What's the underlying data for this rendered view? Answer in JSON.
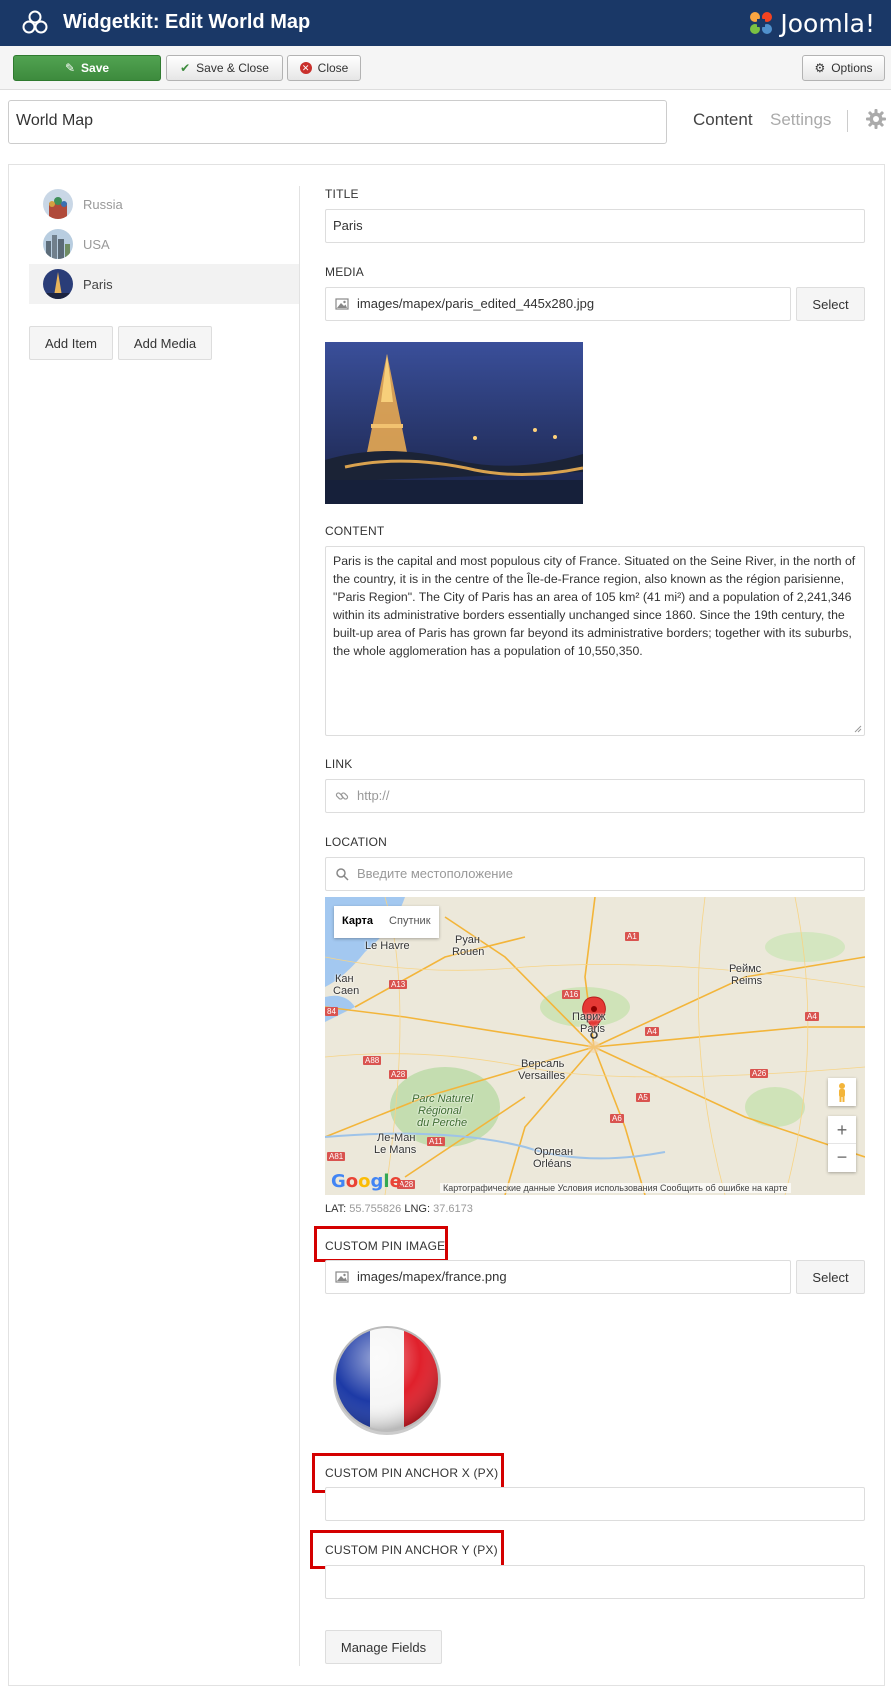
{
  "header": {
    "title": "Widgetkit: Edit World Map",
    "brand": "Joomla!"
  },
  "toolbar": {
    "save_label": "Save",
    "save_close_label": "Save & Close",
    "close_label": "Close",
    "options_label": "Options"
  },
  "widget": {
    "name": "World Map"
  },
  "tabs": {
    "content": "Content",
    "settings": "Settings"
  },
  "items": [
    {
      "label": "Russia"
    },
    {
      "label": "USA"
    },
    {
      "label": "Paris"
    }
  ],
  "item_buttons": {
    "add_item": "Add Item",
    "add_media": "Add Media"
  },
  "form": {
    "title_label": "TITLE",
    "title_value": "Paris",
    "media_label": "MEDIA",
    "media_value": "images/mapex/paris_edited_445x280.jpg",
    "select_label": "Select",
    "content_label": "CONTENT",
    "content_value": "Paris is the capital and most populous city of France. Situated on the Seine River, in the north of the country, it is in the centre of the Île-de-France region, also known as the région parisienne, \"Paris Region\". The City of Paris has an area of 105 km² (41 mi²) and a population of 2,241,346 within its administrative borders essentially unchanged since 1860. Since the 19th century, the built-up area of Paris has grown far beyond its administrative borders; together with its suburbs, the whole agglomeration has a population of 10,550,350.",
    "link_label": "LINK",
    "link_placeholder": "http://",
    "location_label": "LOCATION",
    "location_placeholder": "Введите местоположение",
    "lat_label": "LAT:",
    "lat_value": "55.755826",
    "lng_label": "LNG:",
    "lng_value": "37.6173",
    "pin_image_label": "CUSTOM PIN IMAGE",
    "pin_image_value": "images/mapex/france.png",
    "anchor_x_label": "CUSTOM PIN ANCHOR X (PX)",
    "anchor_x_value": "",
    "anchor_y_label": "CUSTOM PIN ANCHOR Y (PX)",
    "anchor_y_value": "",
    "manage_fields_label": "Manage Fields"
  },
  "map": {
    "type_map": "Карта",
    "type_satellite": "Спутник",
    "zoom_in": "+",
    "zoom_out": "−",
    "google": "Google",
    "footer": "Картографические данные   Условия использования   Сообщить об ошибке на карте",
    "places": [
      {
        "name": "Le Havre"
      },
      {
        "name": "Руан"
      },
      {
        "name": "Rouen"
      },
      {
        "name": "Кан"
      },
      {
        "name": "Caen"
      },
      {
        "name": "Реймс"
      },
      {
        "name": "Reims"
      },
      {
        "name": "Париж"
      },
      {
        "name": "Paris"
      },
      {
        "name": "Версаль"
      },
      {
        "name": "Versailles"
      },
      {
        "name": "Parc Naturel"
      },
      {
        "name": "Régional"
      },
      {
        "name": "du Perche"
      },
      {
        "name": "Ле-Ман"
      },
      {
        "name": "Le Mans"
      },
      {
        "name": "Орлеан"
      },
      {
        "name": "Orléans"
      }
    ],
    "roads": [
      "A13",
      "A16",
      "A1",
      "A4",
      "A4",
      "A28",
      "A88",
      "A5",
      "A6",
      "A11",
      "A81",
      "A28",
      "A26",
      "84"
    ]
  }
}
